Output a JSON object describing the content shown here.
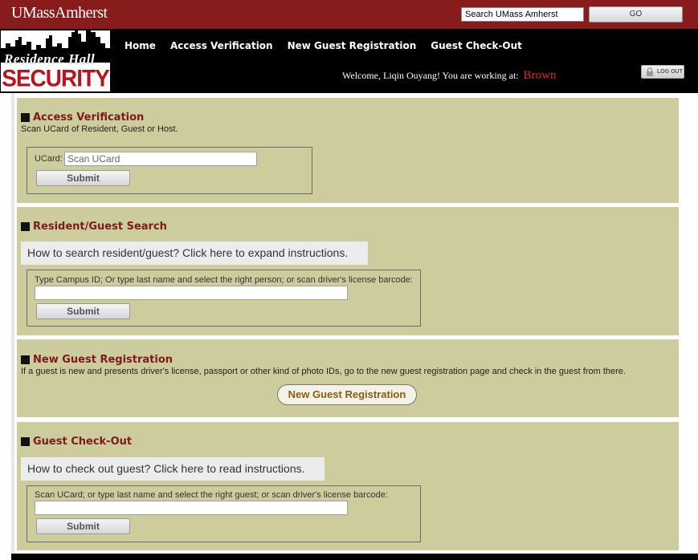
{
  "header": {
    "brand": "UMassAmherst",
    "search_placeholder": "Search UMass Amherst",
    "go_label": "GO"
  },
  "logo": {
    "line1": "Residence Hall",
    "line2": "SECURITY"
  },
  "nav": {
    "items": [
      {
        "label": "Home"
      },
      {
        "label": "Access Verification"
      },
      {
        "label": "New Guest Registration"
      },
      {
        "label": "Guest Check-Out"
      }
    ]
  },
  "welcome": {
    "text": "Welcome, Liqin Ouyang! You are working at:",
    "location": "Brown"
  },
  "logout_label": "LOG OUT",
  "access_verification": {
    "title": "Access Verification",
    "description": "Scan UCard of Resident, Guest or Host.",
    "field_label": "UCard:",
    "field_placeholder": "Scan UCard",
    "submit_label": "Submit"
  },
  "resident_search": {
    "title": "Resident/Guest Search",
    "instructions": "How to search resident/guest? Click here to expand instructions.",
    "field_label": "Type Campus ID; Or type last name and select the right person; or scan driver's license barcode:",
    "submit_label": "Submit"
  },
  "new_guest": {
    "title": "New Guest Registration",
    "description": "If a guest is new and presents driver's license, passport or other kind of photo IDs, go to the new guest registration page and check in the guest from there.",
    "button_label": "New Guest Registration"
  },
  "guest_checkout": {
    "title": "Guest Check-Out",
    "instructions": "How to check out guest? Click here to read instructions.",
    "field_label": "Scan UCard; or type last name and select the right guest; or scan driver's license barcode:",
    "submit_label": "Submit"
  },
  "colors": {
    "maroon": "#881c1c",
    "panel": "#cccc9c",
    "heading": "#7d1a1a",
    "location": "#e0242c"
  }
}
